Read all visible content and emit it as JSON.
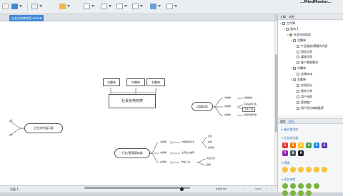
{
  "toolbar": {
    "right_label": "...MindMaster..."
  },
  "tab": {
    "label": "社会化电商框架.emmx",
    "close": "✕"
  },
  "map": {
    "center": "社会化电商类",
    "top": [
      "北翼单",
      "中翼单",
      "右翼单"
    ],
    "left": "企业对外展示类",
    "right1": {
      "label": "自媒体类",
      "items": [
        "中翼单",
        "中翼单",
        "中翼单"
      ],
      "subs": [
        "内容推送",
        "互动品牌打造",
        "企业介绍",
        "内容传播管理"
      ]
    },
    "right2": {
      "label": "行业/垂直媒体类",
      "items": [
        "北翼单",
        "中翼单",
        "右翼单"
      ],
      "subs": [
        "内容推送企业",
        "社区",
        "主营企业推荐",
        "快速入驻",
        "商务合作",
        "招聘"
      ],
      "far": [
        "电商",
        "多媒体"
      ]
    },
    "left_small": [
      "单",
      "单"
    ]
  },
  "status": {
    "page": "页面-1",
    "zoom_text": "在四键 放大",
    "zoom": "100%",
    "plus": "+",
    "minus": "−"
  },
  "panel": {
    "tabs": [
      "大纲",
      "浏览"
    ],
    "tree": [
      {
        "label": "工作簿",
        "level": 0
      },
      {
        "label": "画布 1",
        "level": 1
      },
      {
        "label": "社会化电商类",
        "level": 2
      },
      {
        "label": "北翼单",
        "level": 3
      },
      {
        "label": "产品服务/想要的内容",
        "level": 4
      },
      {
        "label": "团队信息",
        "level": 4
      },
      {
        "label": "媒体优质",
        "level": 4
      },
      {
        "label": "客户营销需求",
        "level": 4
      },
      {
        "label": "中翼单",
        "level": 3
      },
      {
        "label": "店铺wap",
        "level": 4
      },
      {
        "label": "右翼单",
        "level": 3
      },
      {
        "label": "发现积分",
        "level": 4
      },
      {
        "label": "我的订单",
        "level": 4
      },
      {
        "label": "用户社群",
        "level": 4
      },
      {
        "label": "营销推广",
        "level": 4
      },
      {
        "label": "用户积分商城推荐",
        "level": 4
      }
    ],
    "prop_tabs": [
      "属性",
      "图标"
    ],
    "sections": [
      "最近使用的",
      "任务优先级",
      "表情",
      "任务进度"
    ],
    "priorities": [
      "1",
      "2",
      "3",
      "4",
      "5",
      "6",
      "7",
      "8",
      "9"
    ],
    "colors": {
      "p1": "#e53935",
      "p2": "#f57c00",
      "p3": "#fbc02d",
      "p4": "#43a047",
      "p5": "#1e88e5",
      "p6": "#5e35b1",
      "p7": "#8e24aa",
      "p8": "#455a64",
      "p9": "#212121",
      "accent": "#3f88d6"
    }
  }
}
